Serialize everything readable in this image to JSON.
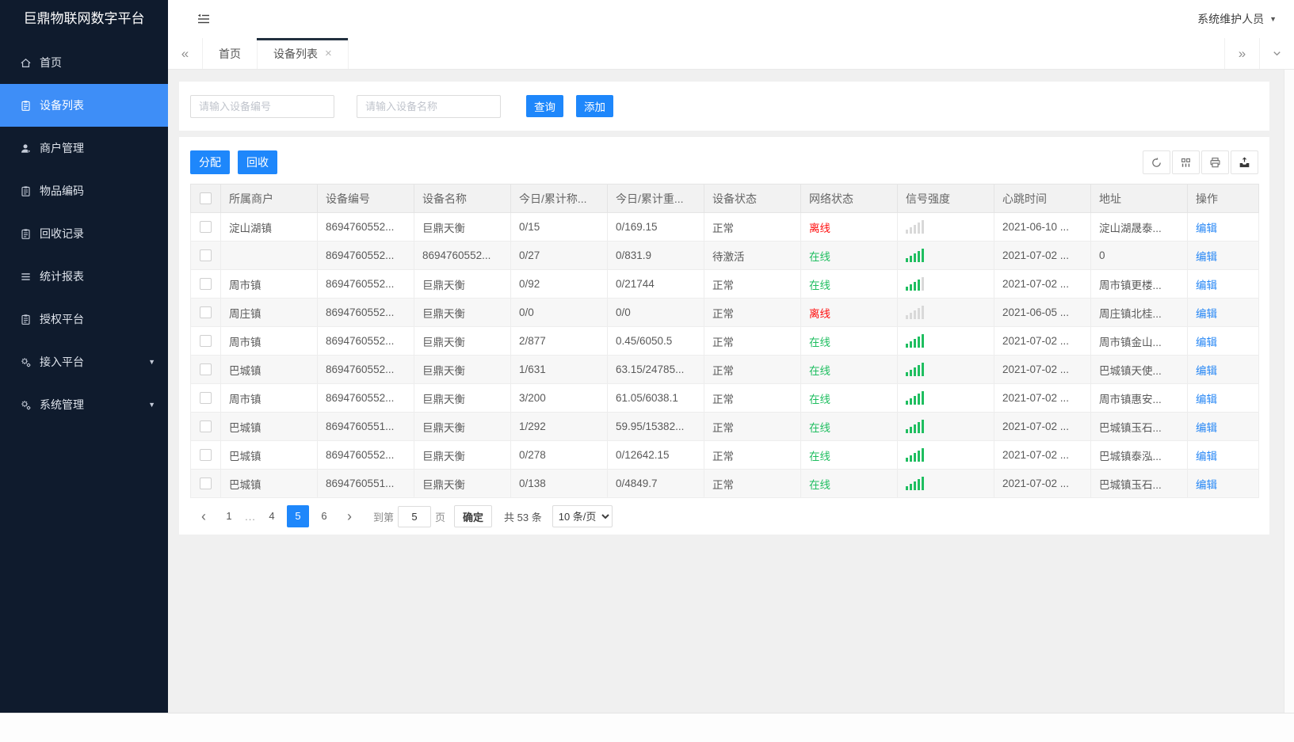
{
  "app": {
    "title": "巨鼎物联网数字平台",
    "user_label": "系统维护人员"
  },
  "sidebar": {
    "items": [
      {
        "icon": "home",
        "label": "首页",
        "active": false,
        "arrow": false
      },
      {
        "icon": "clipboard",
        "label": "设备列表",
        "active": true,
        "arrow": false
      },
      {
        "icon": "user",
        "label": "商户管理",
        "active": false,
        "arrow": false
      },
      {
        "icon": "clipboard",
        "label": "物品编码",
        "active": false,
        "arrow": false
      },
      {
        "icon": "clipboard",
        "label": "回收记录",
        "active": false,
        "arrow": false
      },
      {
        "icon": "lines",
        "label": "统计报表",
        "active": false,
        "arrow": false
      },
      {
        "icon": "clipboard",
        "label": "授权平台",
        "active": false,
        "arrow": false
      },
      {
        "icon": "gear",
        "label": "接入平台",
        "active": false,
        "arrow": true
      },
      {
        "icon": "gear",
        "label": "系统管理",
        "active": false,
        "arrow": true
      }
    ]
  },
  "tabs": {
    "back_icon": "«",
    "forward_icon": "»",
    "items": [
      {
        "label": "首页",
        "active": false,
        "closable": false
      },
      {
        "label": "设备列表",
        "active": true,
        "closable": true
      }
    ],
    "close_icon": "×"
  },
  "search": {
    "device_no_placeholder": "请输入设备编号",
    "device_name_placeholder": "请输入设备名称",
    "query_label": "查询",
    "add_label": "添加"
  },
  "toolbar": {
    "assign_label": "分配",
    "recycle_label": "回收"
  },
  "table": {
    "columns": [
      "所属商户",
      "设备编号",
      "设备名称",
      "今日/累计称...",
      "今日/累计重...",
      "设备状态",
      "网络状态",
      "信号强度",
      "心跳时间",
      "地址",
      "操作"
    ],
    "rows": [
      {
        "merchant": "淀山湖镇",
        "device_no": "8694760552...",
        "device_name": "巨鼎天衡",
        "today_count": "0/15",
        "today_weight": "0/169.15",
        "device_status": "正常",
        "network_status": "离线",
        "network_online": false,
        "signal": 0,
        "heartbeat": "2021-06-10 ...",
        "address": "淀山湖晟泰...",
        "action": "编辑"
      },
      {
        "merchant": "",
        "device_no": "8694760552...",
        "device_name": "8694760552...",
        "today_count": "0/27",
        "today_weight": "0/831.9",
        "device_status": "待激活",
        "network_status": "在线",
        "network_online": true,
        "signal": 5,
        "heartbeat": "2021-07-02 ...",
        "address": "0",
        "action": "编辑"
      },
      {
        "merchant": "周市镇",
        "device_no": "8694760552...",
        "device_name": "巨鼎天衡",
        "today_count": "0/92",
        "today_weight": "0/21744",
        "device_status": "正常",
        "network_status": "在线",
        "network_online": true,
        "signal": 4,
        "heartbeat": "2021-07-02 ...",
        "address": "周市镇更楼...",
        "action": "编辑"
      },
      {
        "merchant": "周庄镇",
        "device_no": "8694760552...",
        "device_name": "巨鼎天衡",
        "today_count": "0/0",
        "today_weight": "0/0",
        "device_status": "正常",
        "network_status": "离线",
        "network_online": false,
        "signal": 0,
        "heartbeat": "2021-06-05 ...",
        "address": "周庄镇北桂...",
        "action": "编辑"
      },
      {
        "merchant": "周市镇",
        "device_no": "8694760552...",
        "device_name": "巨鼎天衡",
        "today_count": "2/877",
        "today_weight": "0.45/6050.5",
        "device_status": "正常",
        "network_status": "在线",
        "network_online": true,
        "signal": 5,
        "heartbeat": "2021-07-02 ...",
        "address": "周市镇金山...",
        "action": "编辑"
      },
      {
        "merchant": "巴城镇",
        "device_no": "8694760552...",
        "device_name": "巨鼎天衡",
        "today_count": "1/631",
        "today_weight": "63.15/24785...",
        "device_status": "正常",
        "network_status": "在线",
        "network_online": true,
        "signal": 5,
        "heartbeat": "2021-07-02 ...",
        "address": "巴城镇天使...",
        "action": "编辑"
      },
      {
        "merchant": "周市镇",
        "device_no": "8694760552...",
        "device_name": "巨鼎天衡",
        "today_count": "3/200",
        "today_weight": "61.05/6038.1",
        "device_status": "正常",
        "network_status": "在线",
        "network_online": true,
        "signal": 5,
        "heartbeat": "2021-07-02 ...",
        "address": "周市镇惠安...",
        "action": "编辑"
      },
      {
        "merchant": "巴城镇",
        "device_no": "8694760551...",
        "device_name": "巨鼎天衡",
        "today_count": "1/292",
        "today_weight": "59.95/15382...",
        "device_status": "正常",
        "network_status": "在线",
        "network_online": true,
        "signal": 5,
        "heartbeat": "2021-07-02 ...",
        "address": "巴城镇玉石...",
        "action": "编辑"
      },
      {
        "merchant": "巴城镇",
        "device_no": "8694760552...",
        "device_name": "巨鼎天衡",
        "today_count": "0/278",
        "today_weight": "0/12642.15",
        "device_status": "正常",
        "network_status": "在线",
        "network_online": true,
        "signal": 5,
        "heartbeat": "2021-07-02 ...",
        "address": "巴城镇泰泓...",
        "action": "编辑"
      },
      {
        "merchant": "巴城镇",
        "device_no": "8694760551...",
        "device_name": "巨鼎天衡",
        "today_count": "0/138",
        "today_weight": "0/4849.7",
        "device_status": "正常",
        "network_status": "在线",
        "network_online": true,
        "signal": 5,
        "heartbeat": "2021-07-02 ...",
        "address": "巴城镇玉石...",
        "action": "编辑"
      }
    ]
  },
  "pagination": {
    "prev_icon": "‹",
    "next_icon": "›",
    "pages": [
      "1",
      "...",
      "4",
      "5",
      "6"
    ],
    "active_page": "5",
    "goto_label": "到第",
    "goto_value": "5",
    "page_unit_label": "页",
    "confirm_label": "确定",
    "total_label": "共 53 条",
    "page_size_label": "10 条/页"
  },
  "colors": {
    "primary": "#1e87fb",
    "sidebar_bg": "#0f1b2d",
    "sidebar_active": "#3e8ef7",
    "online_green": "#1fbe60",
    "offline_red": "#ff0f0f",
    "link_blue": "#2787f5"
  }
}
